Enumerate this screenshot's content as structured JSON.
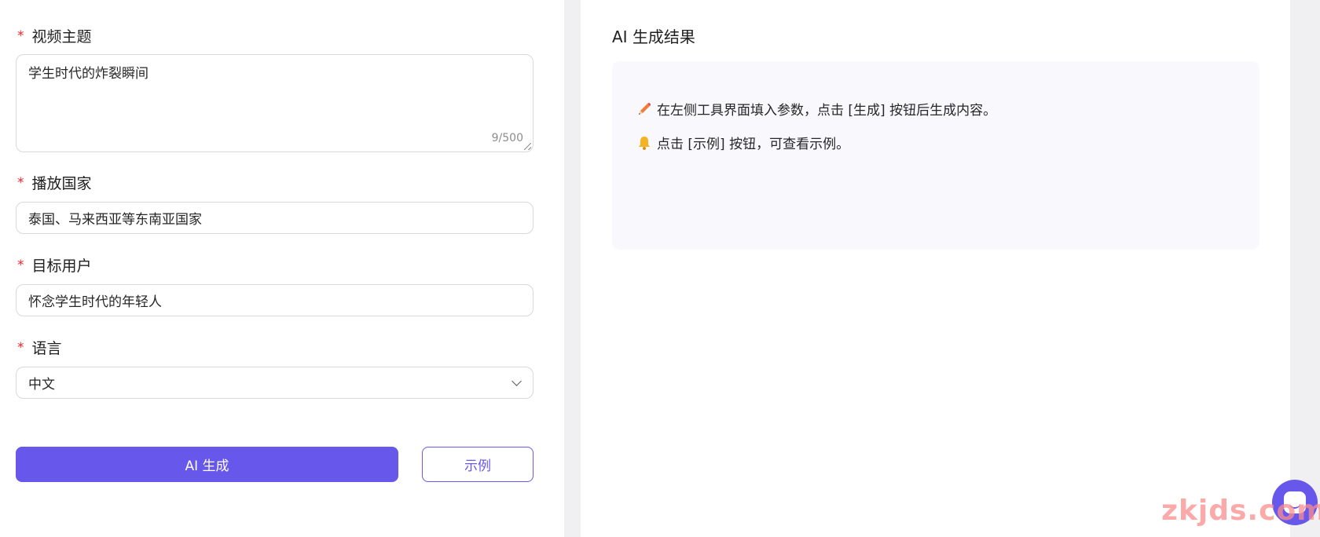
{
  "form": {
    "required_mark": "*",
    "topic": {
      "label": "视频主题",
      "value": "学生时代的炸裂瞬间",
      "counter": "9/500"
    },
    "country": {
      "label": "播放国家",
      "value": "泰国、马来西亚等东南亚国家"
    },
    "audience": {
      "label": "目标用户",
      "value": "怀念学生时代的年轻人"
    },
    "language": {
      "label": "语言",
      "value": "中文"
    },
    "generate_label": "AI 生成",
    "example_label": "示例"
  },
  "result": {
    "title": "AI 生成结果",
    "hints": [
      {
        "icon": "pencil-icon",
        "text": "在左侧工具界面填入参数，点击 [生成] 按钮后生成内容。"
      },
      {
        "icon": "bell-icon",
        "text": "点击 [示例] 按钮，可查看示例。"
      }
    ]
  },
  "watermark": "zkjds.com",
  "colors": {
    "accent": "#6757eb",
    "required": "#f5222d"
  }
}
